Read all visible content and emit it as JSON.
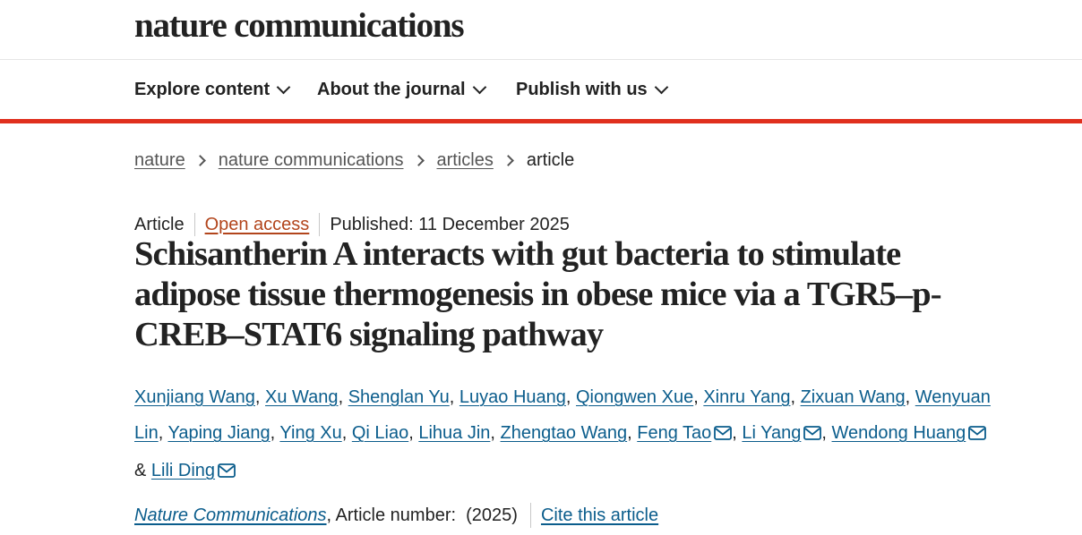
{
  "header": {
    "brand": "nature communications"
  },
  "nav": [
    {
      "label": "Explore content"
    },
    {
      "label": "About the journal"
    },
    {
      "label": "Publish with us"
    }
  ],
  "breadcrumb": {
    "items": [
      "nature",
      "nature communications",
      "articles"
    ],
    "current": "article"
  },
  "meta": {
    "type": "Article",
    "access": "Open access",
    "published": "Published: 11 December 2025"
  },
  "title": "Schisantherin A interacts with gut bacteria to stimulate adipose tissue thermogenesis in obese mice via a TGR5–p-CREB–STAT6 signaling pathway",
  "authors": [
    {
      "name": "Xunjiang Wang"
    },
    {
      "name": "Xu Wang"
    },
    {
      "name": "Shenglan Yu"
    },
    {
      "name": "Luyao Huang"
    },
    {
      "name": "Qiongwen Xue"
    },
    {
      "name": "Xinru Yang"
    },
    {
      "name": "Zixuan Wang"
    },
    {
      "name": "Wenyuan Lin"
    },
    {
      "name": "Yaping Jiang"
    },
    {
      "name": "Ying Xu"
    },
    {
      "name": "Qi Liao"
    },
    {
      "name": "Lihua Jin"
    },
    {
      "name": "Zhengtao Wang"
    },
    {
      "name": "Feng Tao"
    },
    {
      "name": "Li Yang"
    },
    {
      "name": "Wendong Huang"
    },
    {
      "name": "Lili Ding"
    }
  ],
  "author_separator": ", ",
  "author_last_separator": " & ",
  "journal_line": {
    "journal": "Nature Communications",
    "article_number": ", Article number:  (2025)",
    "cite": "Cite this article"
  },
  "colors": {
    "accent_bar": "#e0301e",
    "link": "#0b5d8c",
    "open_access": "#b2451c"
  }
}
